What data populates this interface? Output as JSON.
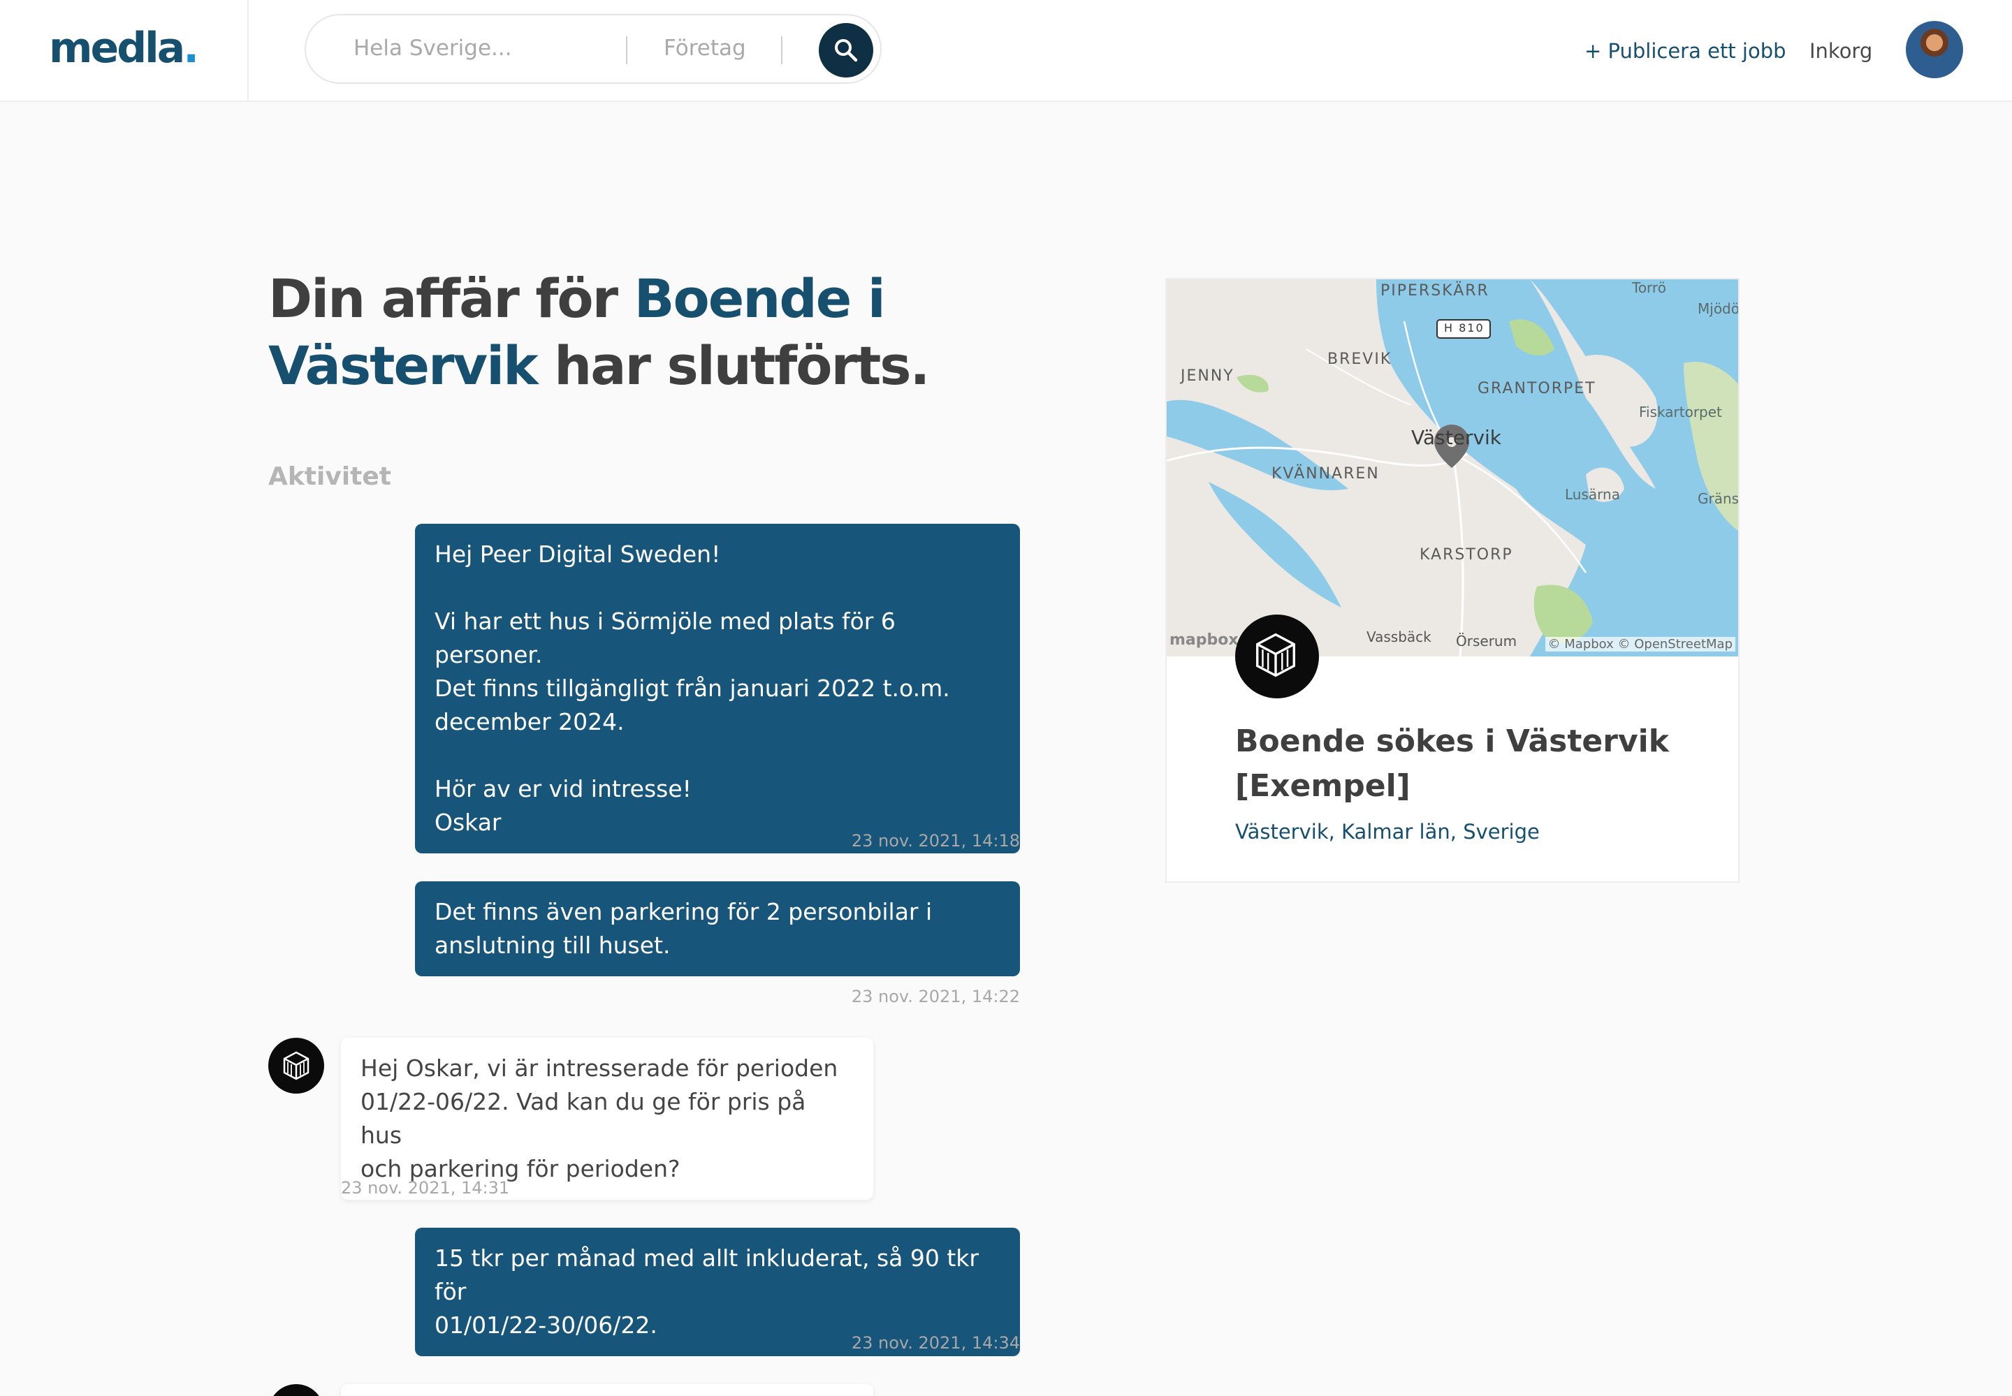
{
  "header": {
    "logo_text": "medla",
    "logo_dot": ".",
    "search": {
      "location_placeholder": "Hela Sverige...",
      "company_placeholder": "Företag"
    },
    "nav": {
      "publish_label": "+ Publicera ett jobb",
      "inbox_label": "Inkorg"
    }
  },
  "main": {
    "headline_prefix": "Din affär för ",
    "headline_accent": "Boende i Västervik",
    "headline_suffix": " har slutförts.",
    "activity_label": "Aktivitet"
  },
  "messages": [
    {
      "direction": "out",
      "lines": [
        "Hej Peer Digital Sweden!",
        "",
        "Vi har ett hus i Sörmjöle med plats för 6 personer.",
        "Det finns tillgängligt från januari 2022 t.o.m.",
        "december 2024.",
        "",
        "Hör av er vid intresse!",
        "Oskar"
      ],
      "timestamp": "23 nov. 2021, 14:18"
    },
    {
      "direction": "out",
      "lines": [
        "Det finns även parkering för 2 personbilar i",
        "anslutning till huset."
      ],
      "timestamp": "23 nov. 2021, 14:22"
    },
    {
      "direction": "in",
      "lines": [
        "Hej Oskar, vi är intresserade för perioden",
        "01/22-06/22. Vad kan du ge för pris på hus",
        "och parkering för perioden?"
      ],
      "timestamp": "23 nov. 2021, 14:31"
    },
    {
      "direction": "out",
      "lines": [
        "15 tkr per månad med allt inkluderat, så 90 tkr för",
        "01/01/22-30/06/22."
      ],
      "timestamp": "23 nov. 2021, 14:34"
    }
  ],
  "listing": {
    "title": "Boende sökes i Västervik [Exempel]",
    "location": "Västervik, Kalmar län, Sverige",
    "map": {
      "labels": {
        "piperskarr": "PIPERSKÄRR",
        "road": "H 810",
        "torro": "Torrö",
        "mjodo": "Mjödö",
        "brevik": "BREVIK",
        "jenny": "JENNY",
        "grantorpet": "GRANTORPET",
        "fiskartorpet": "Fiskartorpet",
        "vastervik": "Västervik",
        "kvannaren": "KVÄNNAREN",
        "lusarna": "Lusärna",
        "grans": "Gräns",
        "karstorp": "KARSTORP",
        "vassback": "Vassbäck",
        "orserum": "Örserum"
      },
      "logo": "mapbox",
      "attribution": "© Mapbox © OpenStreetMap"
    }
  },
  "colors": {
    "brand": "#17506f",
    "bubble_out": "#17557a",
    "search_button": "#0f2f45"
  }
}
